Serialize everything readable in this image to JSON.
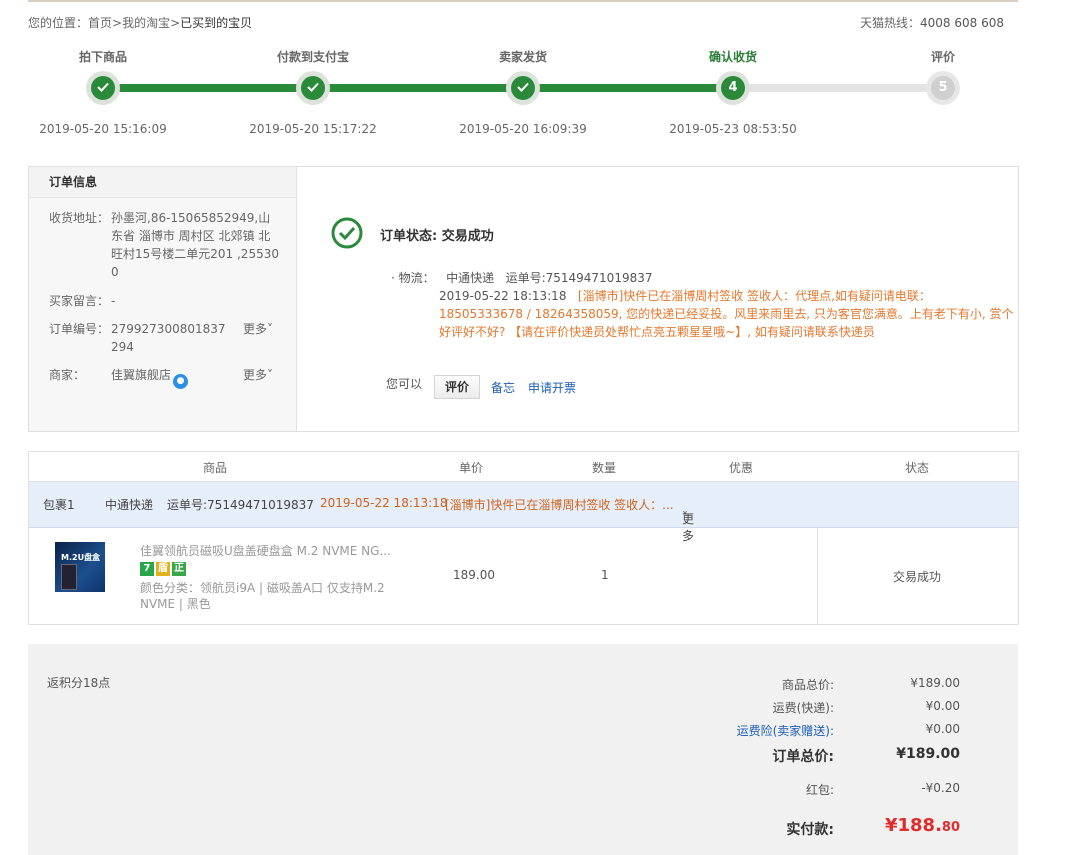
{
  "breadcrumb": {
    "prefix": "您的位置：",
    "home": "首页",
    "sep": ">",
    "mytaobao": "我的淘宝",
    "current": "已买到的宝贝"
  },
  "hotline": {
    "label": "天猫热线：",
    "number": "4008 608 608"
  },
  "steps": [
    {
      "label": "拍下商品",
      "time": "2019-05-20 15:16:09",
      "state": "done"
    },
    {
      "label": "付款到支付宝",
      "time": "2019-05-20 15:17:22",
      "state": "done"
    },
    {
      "label": "卖家发货",
      "time": "2019-05-20 16:09:39",
      "state": "done"
    },
    {
      "label": "确认收货",
      "time": "2019-05-23 08:53:50",
      "state": "current",
      "number": "4"
    },
    {
      "label": "评价",
      "time": "",
      "state": "pending",
      "number": "5"
    }
  ],
  "order_info": {
    "title": "订单信息",
    "address_label": "收货地址：",
    "address": "孙墨河,86-15065852949,山东省 淄博市 周村区 北郊镇 北旺村15号楼二单元201 ,255300",
    "message_label": "买家留言：",
    "message": "-",
    "order_no_label": "订单编号：",
    "order_no": "279927300801837294",
    "more": "更多",
    "merchant_label": "商家：",
    "merchant": "佳翼旗舰店"
  },
  "status": {
    "title": "订单状态: 交易成功",
    "logistics_label": "· 物流：",
    "carrier": "中通快递",
    "waybill": "运单号:75149471019837",
    "log_time": "2019-05-22 18:13:18",
    "log_text": "[淄博市]快件已在淄博周村签收 签收人：代理点,如有疑问请电联：18505333678 / 18264358059, 您的快递已经妥投。风里来雨里去, 只为客官您满意。上有老下有小, 赏个好评好不好? 【请在评价快递员处帮忙点亮五颗星星哦~】, 如有疑问请联系快递员",
    "you_can": "您可以",
    "btn_rate": "评价",
    "link_memo": "备忘",
    "link_invoice": "申请开票"
  },
  "goods": {
    "headers": {
      "product": "商品",
      "price": "单价",
      "qty": "数量",
      "discount": "优惠",
      "status": "状态"
    },
    "package": {
      "name": "包裹1",
      "carrier": "中通快递",
      "waybill": "运单号:75149471019837",
      "time": "2019-05-22 18:13:18",
      "text": "[淄博市]快件已在淄博周村签收 签收人：...",
      "more": "更多"
    },
    "item": {
      "thumb_text": "M.2U盘盒",
      "title": "佳翼领航员磁吸U盘盖硬盘盒 M.2 NVME NG...",
      "badges": [
        "7",
        "盾",
        "正"
      ],
      "attr": "颜色分类：领航员i9A | 磁吸盖A口 仅支持M.2 NVME | 黑色",
      "price": "189.00",
      "qty": "1",
      "status": "交易成功"
    }
  },
  "totals": {
    "points": "返积分18点",
    "goods_total_label": "商品总价:",
    "goods_total": "¥189.00",
    "shipping_label": "运费(快递):",
    "shipping": "¥0.00",
    "insurance_label": "运费险(卖家赠送):",
    "insurance": "¥0.00",
    "order_total_label": "订单总价:",
    "order_total": "¥189.00",
    "redpacket_label": "红包:",
    "redpacket": "-¥0.20",
    "paid_label": "实付款:",
    "paid_main": "¥188.",
    "paid_cents": "80"
  },
  "colors": {
    "progress": "#2a8a3a",
    "link": "#1d5db6",
    "log_orange": "#e4772c",
    "pay_red": "#e22b2b"
  }
}
